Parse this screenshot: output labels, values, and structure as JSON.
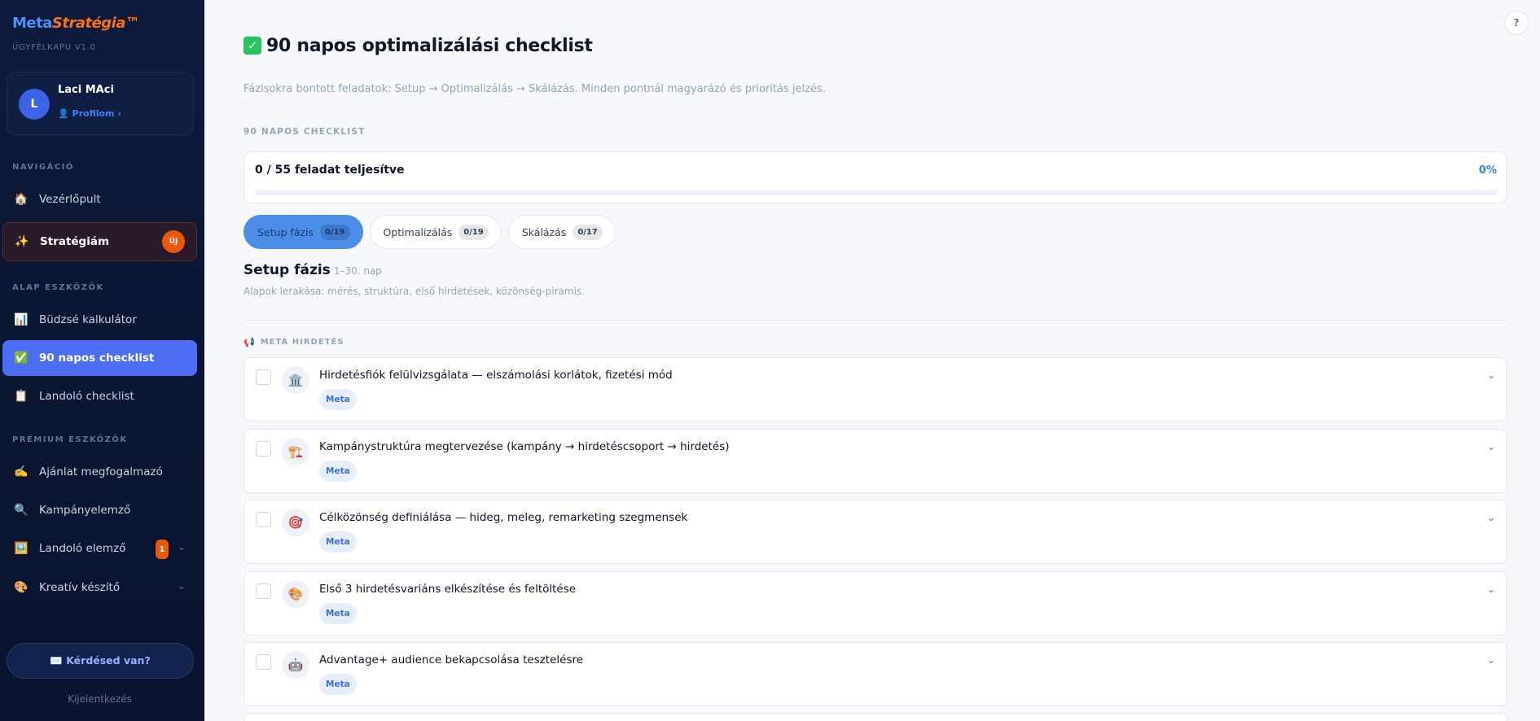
{
  "brand": {
    "meta": "Meta",
    "strategy": "Stratégia",
    "tm": "™",
    "version": "ÜGYFÉLKAPU V1.0"
  },
  "user": {
    "initial": "L",
    "name": "Laci MAci",
    "profile_link": "👤 Profilom ›"
  },
  "sidebar": {
    "section_nav": "NAVIGÁCIÓ",
    "dashboard": {
      "icon": "🏠",
      "label": "Vezérlőpult"
    },
    "strategy": {
      "icon": "✨",
      "label": "Stratégiám",
      "badge": "ÚJ"
    },
    "section_basic": "ALAP ESZKÖZÖK",
    "basic_items": [
      {
        "icon": "📊",
        "label": "Büdzsé kalkulátor"
      },
      {
        "icon": "✅",
        "label": "90 napos checklist"
      },
      {
        "icon": "📋",
        "label": "Landoló checklist"
      }
    ],
    "section_premium": "PRÉMIUM ESZKÖZÖK",
    "premium_items": [
      {
        "icon": "✍️",
        "label": "Ajánlat megfogalmazó"
      },
      {
        "icon": "🔍",
        "label": "Kampányelemző"
      },
      {
        "icon": "🖼️",
        "label": "Landoló elemző",
        "badge": "1",
        "chevron": "⌄"
      },
      {
        "icon": "🎨",
        "label": "Kreatív készítő",
        "chevron": "⌄"
      }
    ],
    "question_button": "✉️ Kérdésed van?",
    "logout": "Kijelentkezés"
  },
  "header": {
    "help": "?"
  },
  "page": {
    "title_icon": "✓",
    "title": "90 napos optimalizálási checklist",
    "subtitle": "Fázisokra bontott feladatok: Setup → Optimalizálás → Skálázás. Minden pontnál magyarázó és prioritás jelzés.",
    "section_label": "90 NAPOS CHECKLIST",
    "progress": {
      "text": "0 / 55 feladat teljesítve",
      "percent_label": "0%",
      "fraction": 0
    }
  },
  "tabs": [
    {
      "label": "Setup fázis",
      "count": "0/19",
      "active": true
    },
    {
      "label": "Optimalizálás",
      "count": "0/19",
      "active": false
    },
    {
      "label": "Skálázás",
      "count": "0/17",
      "active": false
    }
  ],
  "phase": {
    "title": "Setup fázis",
    "days": "1–30. nap",
    "description": "Alapok lerakása: mérés, struktúra, első hirdetések, közönség-piramis."
  },
  "group": {
    "icon": "📢",
    "label": "META HIRDETÉS"
  },
  "tasks": [
    {
      "icon": "🏛️",
      "title": "Hirdetésfiók felülvizsgálata — elszámolási korlátok, fizetési mód",
      "tag": "Meta",
      "chevron": "⌄"
    },
    {
      "icon": "🏗️",
      "title": "Kampánystruktúra megtervezése (kampány → hirdetéscsoport → hirdetés)",
      "tag": "Meta",
      "chevron": "⌄"
    },
    {
      "icon": "🎯",
      "title": "Célközönség definiálása — hideg, meleg, remarketing szegmensek",
      "tag": "Meta",
      "chevron": "⌄"
    },
    {
      "icon": "🎨",
      "title": "Első 3 hirdetésvariáns elkészítése és feltöltése",
      "tag": "Meta",
      "chevron": "⌄"
    },
    {
      "icon": "🤖",
      "title": "Advantage+ audience bekapcsolása tesztelésre",
      "tag": "Meta",
      "chevron": "⌄"
    }
  ]
}
